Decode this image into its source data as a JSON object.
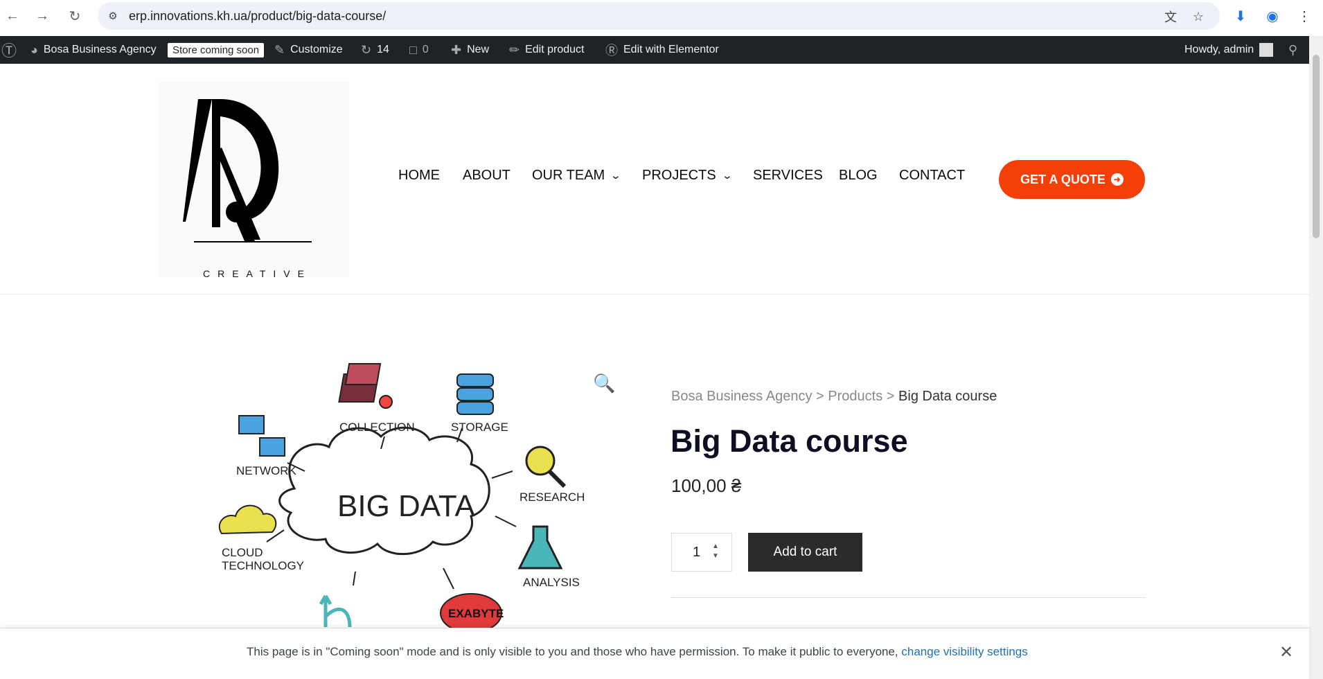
{
  "browser": {
    "url": "erp.innovations.kh.ua/product/big-data-course/"
  },
  "adminbar": {
    "site_name": "Bosa Business Agency",
    "store_badge": "Store coming soon",
    "customize": "Customize",
    "updates_count": "14",
    "comments_count": "0",
    "new": "New",
    "edit_product": "Edit product",
    "edit_elementor": "Edit with Elementor",
    "howdy": "Howdy, admin"
  },
  "header": {
    "logo_text": "CREATIVE",
    "menu": [
      "HOME",
      "ABOUT",
      "OUR TEAM",
      "PROJECTS",
      "SERVICES",
      "BLOG",
      "CONTACT"
    ],
    "quote_button": "GET A QUOTE",
    "accent_color": "#f43f08"
  },
  "product": {
    "breadcrumb": [
      "Bosa Business Agency",
      "Products",
      "Big Data course"
    ],
    "title": "Big Data course",
    "price": "100,00 ₴",
    "quantity": "1",
    "add_to_cart": "Add to cart",
    "image_labels": {
      "center": "BIG DATA",
      "collection": "COLLECTION",
      "storage": "STORAGE",
      "network": "NETWORK",
      "research": "RESEARCH",
      "cloud1": "CLOUD",
      "cloud2": "TECHNOLOGY",
      "analysis": "ANALYSIS",
      "exabyte": "EXABYTE"
    }
  },
  "notice": {
    "message": "This page is in \"Coming soon\" mode and is only visible to you and those who have permission. To make it public to everyone,",
    "link": "change visibility settings"
  }
}
